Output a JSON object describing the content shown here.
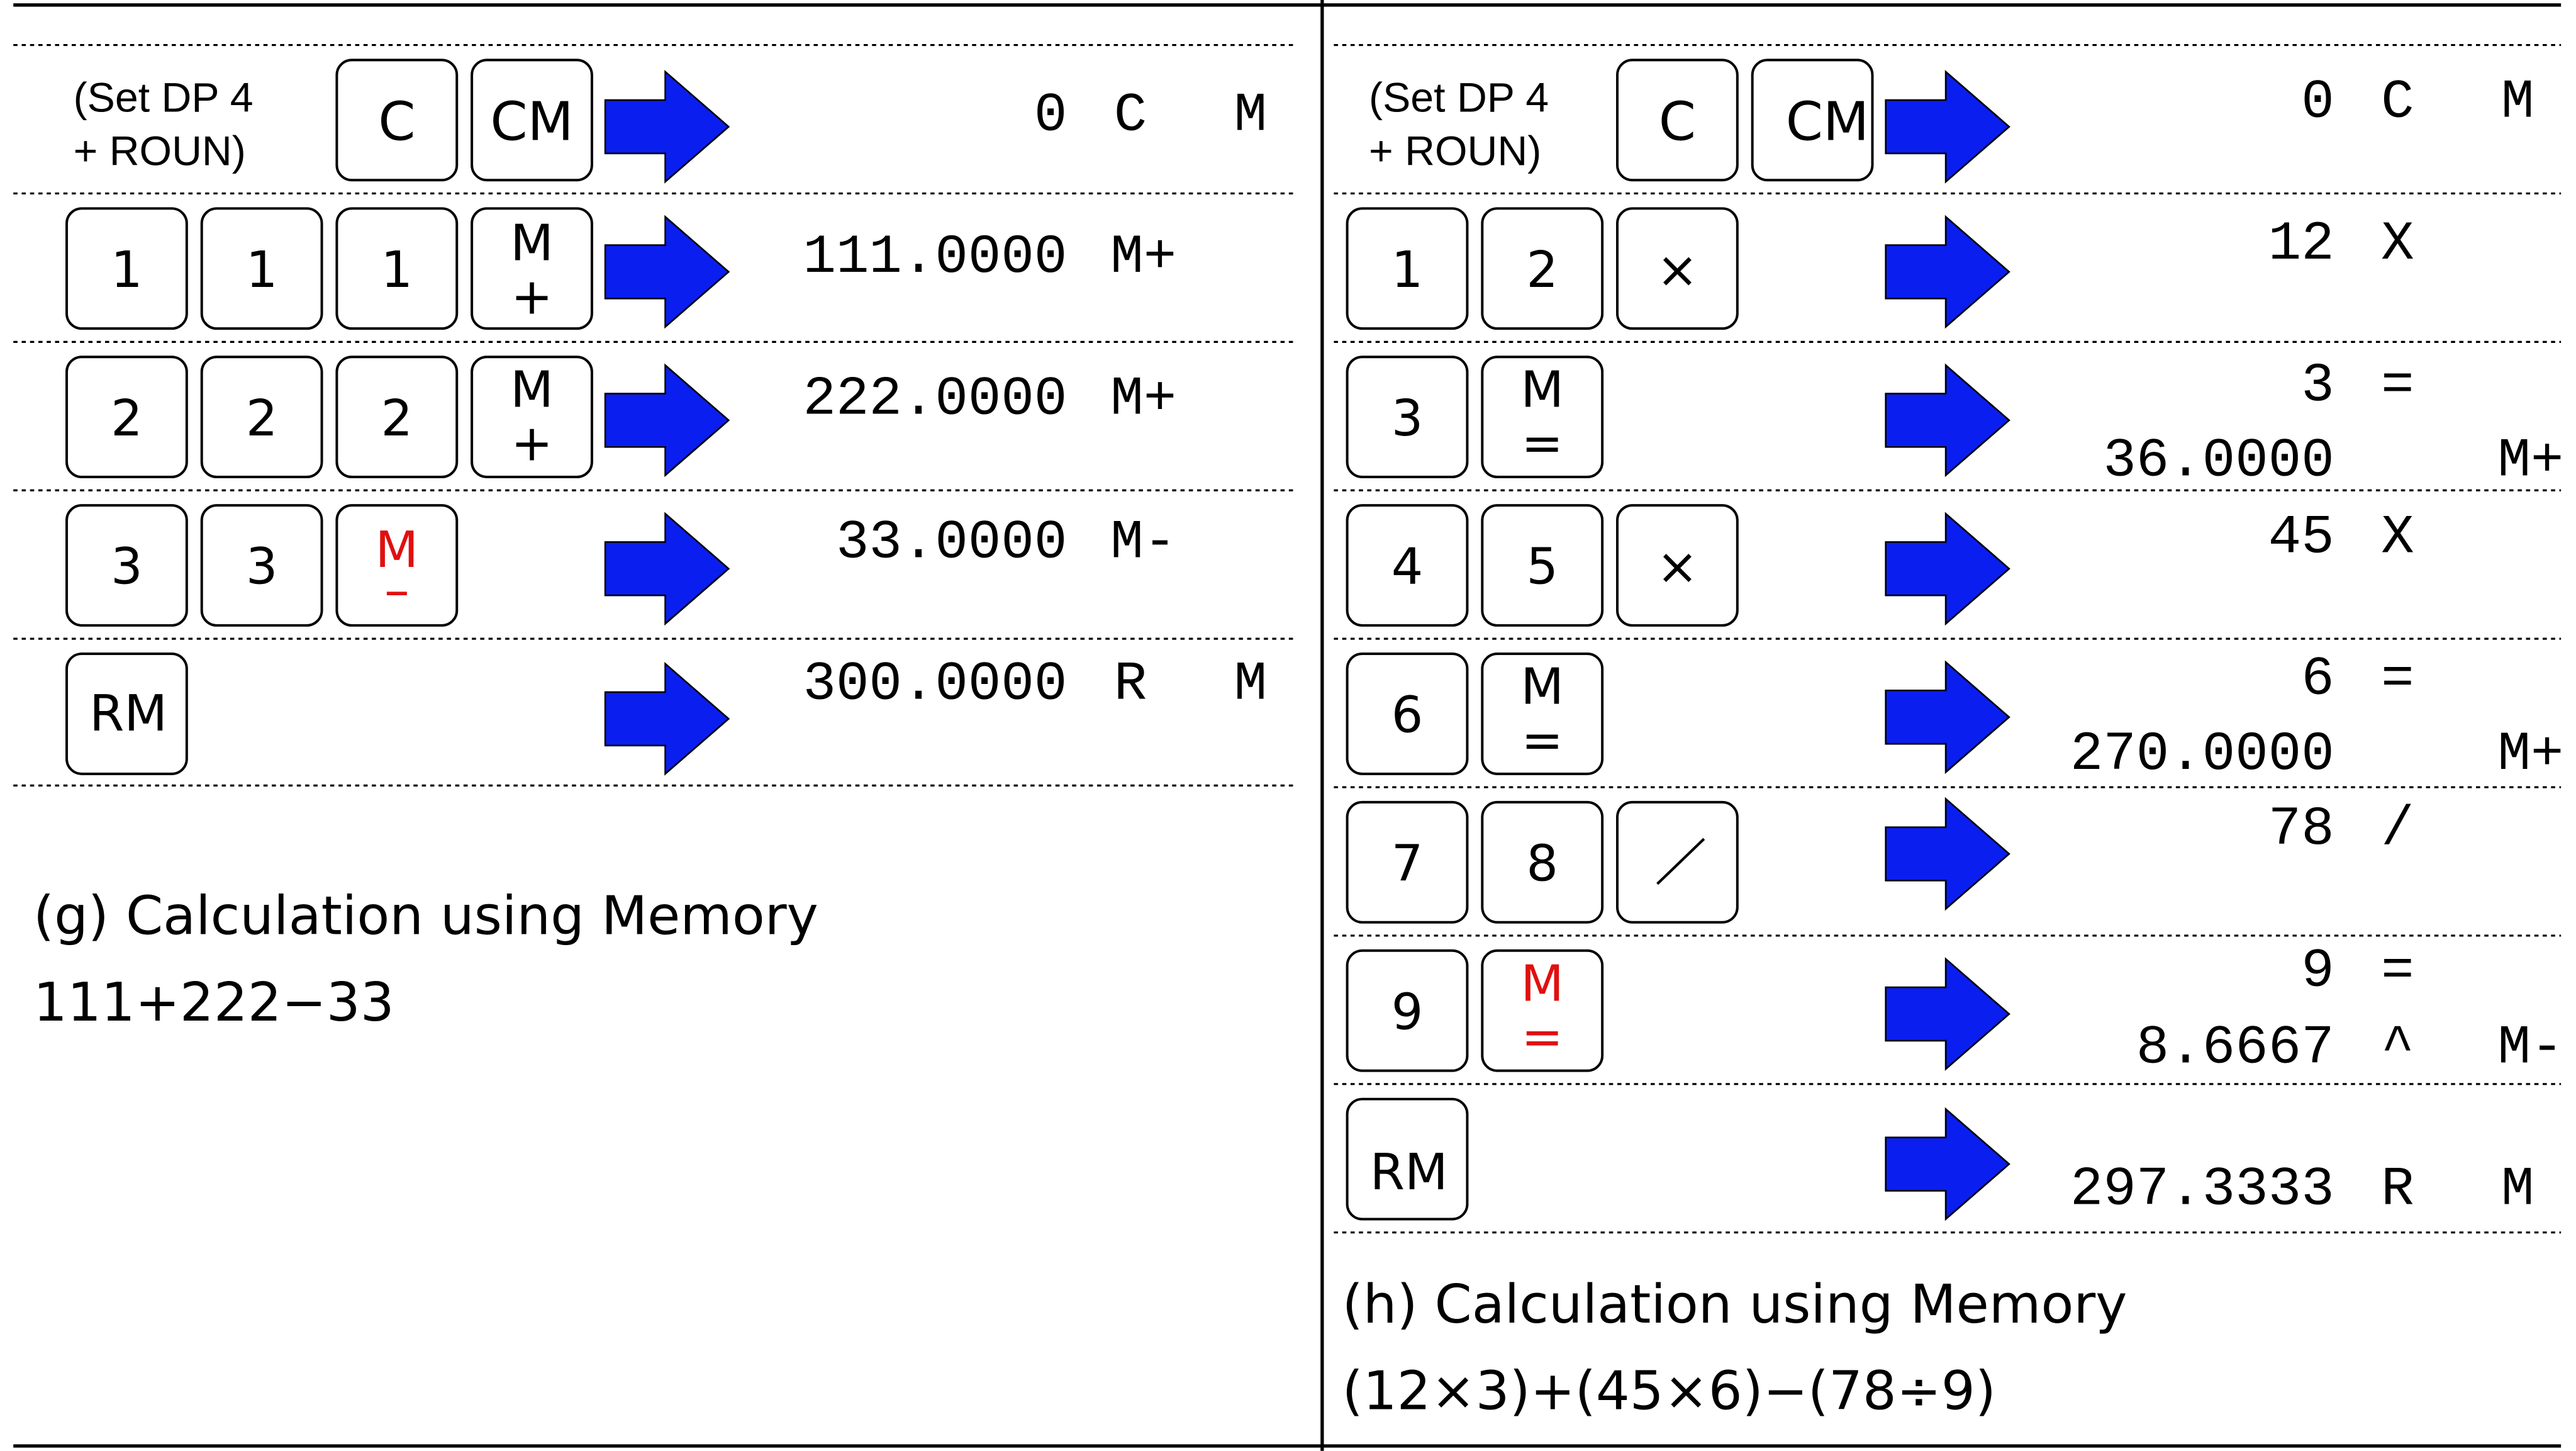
{
  "colors": {
    "arrow": "#0a1ef0",
    "memory_key_red": "#e01010",
    "text": "#000000"
  },
  "left": {
    "rows": [
      {
        "keys": [
          "(Set DP 4",
          "+ ROUN)",
          "C",
          "CM"
        ],
        "display": [
          "0",
          "C",
          "M"
        ]
      },
      {
        "keys": [
          "1",
          "1",
          "1",
          "M",
          "+"
        ],
        "display": [
          "111.0000",
          "M+"
        ]
      },
      {
        "keys": [
          "2",
          "2",
          "2",
          "M",
          "+"
        ],
        "display": [
          "222.0000",
          "M+"
        ]
      },
      {
        "keys": [
          "3",
          "3",
          "M",
          "–"
        ],
        "display": [
          "33.0000",
          "M-"
        ]
      },
      {
        "keys": [
          "RM"
        ],
        "display": [
          "300.0000",
          "R",
          "M"
        ]
      }
    ],
    "caption": "(g) Calculation using Memory",
    "formula": "111+222−33"
  },
  "right": {
    "rows": [
      {
        "keys": [
          "(Set DP 4",
          "+ ROUN)",
          "C",
          "CM"
        ],
        "display": [
          "0",
          "C",
          "M"
        ]
      },
      {
        "keys": [
          "1",
          "2",
          "×"
        ],
        "display": [
          "12",
          "X"
        ]
      },
      {
        "keys": [
          "3",
          "M",
          "="
        ],
        "display": [
          "3",
          "=",
          "36.0000",
          "M+"
        ]
      },
      {
        "keys": [
          "4",
          "5",
          "×"
        ],
        "display": [
          "45",
          "X"
        ]
      },
      {
        "keys": [
          "6",
          "M",
          "="
        ],
        "display": [
          "6",
          "=",
          "270.0000",
          "M+"
        ]
      },
      {
        "keys": [
          "7",
          "8"
        ],
        "display": [
          "78",
          "/"
        ]
      },
      {
        "keys": [
          "9",
          "M",
          "="
        ],
        "display": [
          "9",
          "=",
          "8.6667",
          "^",
          "M-"
        ]
      },
      {
        "keys": [
          "RM"
        ],
        "display": [
          "297.3333",
          "R",
          "M"
        ]
      }
    ],
    "caption": "(h) Calculation using Memory",
    "formula": "(12×3)+(45×6)−(78÷9)"
  }
}
